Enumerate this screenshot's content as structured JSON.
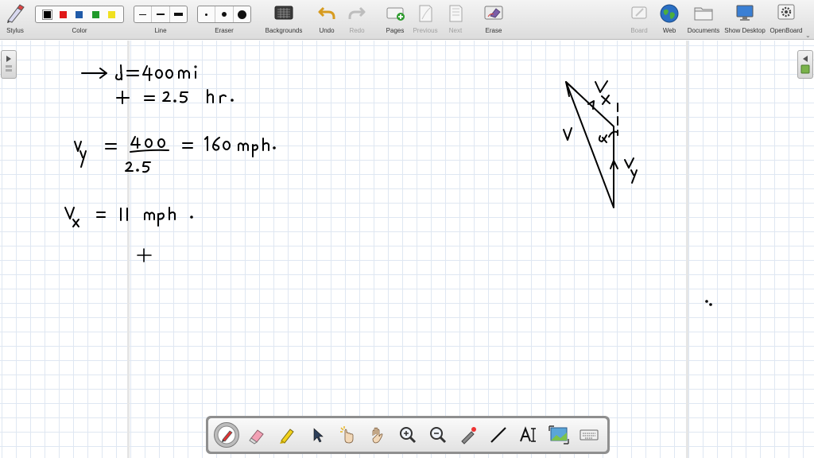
{
  "toolbar": {
    "stylus": "Stylus",
    "color": "Color",
    "line": "Line",
    "eraser": "Eraser",
    "backgrounds": "Backgrounds",
    "undo": "Undo",
    "redo": "Redo",
    "pages": "Pages",
    "previous": "Previous",
    "next": "Next",
    "erase": "Erase",
    "board": "Board",
    "web": "Web",
    "documents": "Documents",
    "show_desktop": "Show Desktop",
    "openboard": "OpenBoard"
  },
  "colors": [
    "#000000",
    "#e01818",
    "#1f5aa8",
    "#1f9a2a",
    "#f0e020"
  ],
  "selected_color": "#000000",
  "bottom_tools": [
    "pen-icon",
    "eraser-icon",
    "marker-icon",
    "selector-icon",
    "interactor-icon",
    "hand-icon",
    "zoom-in-icon",
    "zoom-out-icon",
    "laser-pointer-icon",
    "line-icon",
    "text-icon",
    "capture-icon",
    "keyboard-icon"
  ],
  "active_tool": "pen-icon",
  "ink_color": "#000000"
}
